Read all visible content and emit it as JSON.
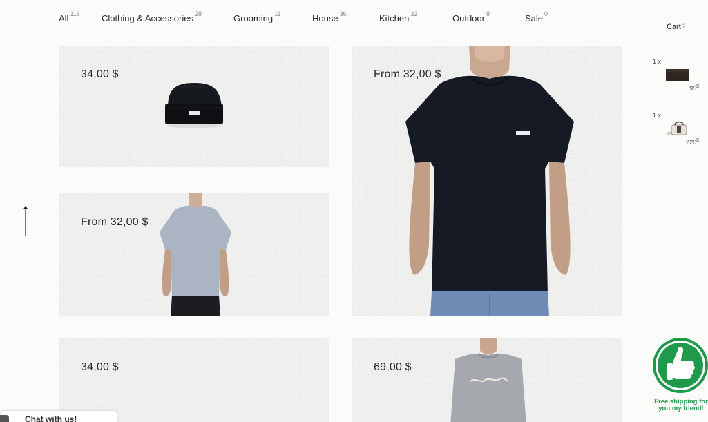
{
  "nav": {
    "items": [
      {
        "label": "All",
        "count": "116"
      },
      {
        "label": "Clothing & Accessories",
        "count": "28"
      },
      {
        "label": "Grooming",
        "count": "11"
      },
      {
        "label": "House",
        "count": "36"
      },
      {
        "label": "Kitchen",
        "count": "32"
      },
      {
        "label": "Outdoor",
        "count": "8"
      },
      {
        "label": "Sale",
        "count": "0"
      }
    ],
    "active": "All"
  },
  "cart": {
    "title": "Cart",
    "count": "2",
    "items": [
      {
        "qty": "1 x",
        "price": "95",
        "currency": "$",
        "icon": "wallet-icon"
      },
      {
        "qty": "1 x",
        "price": "220",
        "currency": "$",
        "icon": "bag-icon"
      }
    ]
  },
  "products": [
    {
      "price": "34,00 $",
      "image": "beanie"
    },
    {
      "price": "From 32,00 $",
      "image": "navy-tshirt"
    },
    {
      "price": "From 32,00 $",
      "image": "grey-tshirt"
    },
    {
      "price": "34,00 $",
      "image": "product"
    },
    {
      "price": "69,00 $",
      "image": "grey-sweatshirt"
    }
  ],
  "promo": {
    "text": "Free shipping for you my friend!",
    "icon": "thumbs-up-icon",
    "color": "#1f9a4b"
  },
  "chat": {
    "label": "Chat with us!"
  },
  "colors": {
    "background": "#fbfbfa",
    "card": "#efefed",
    "accent_green": "#1f9a4b"
  }
}
